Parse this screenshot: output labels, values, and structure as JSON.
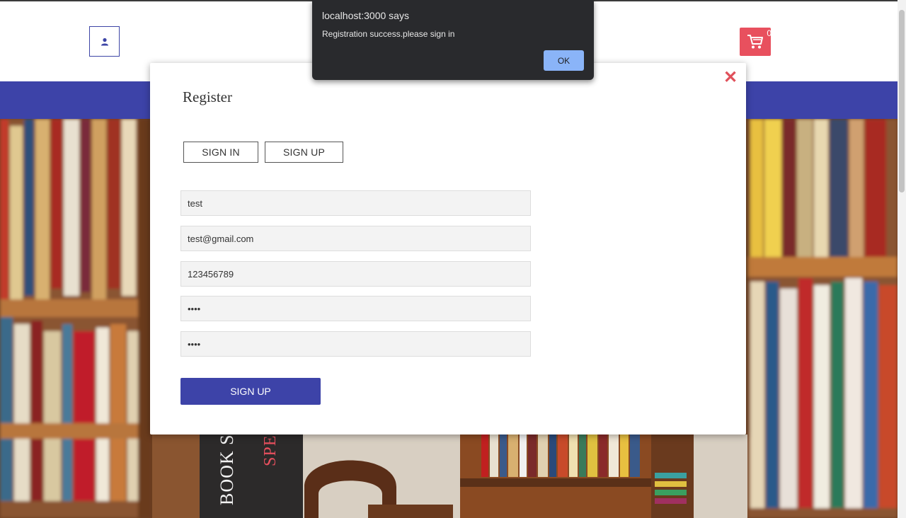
{
  "header": {
    "user_icon": "user-icon",
    "cart_icon": "cart-icon",
    "cart_count": "0",
    "accent_color": "#3d43a8",
    "cart_color": "#e8505e"
  },
  "hero": {
    "sign_text_1": "BOOK S",
    "sign_text_2": "SPE"
  },
  "modal": {
    "title": "Register",
    "close_icon": "close-icon",
    "close_glyph": "✕",
    "tabs": [
      {
        "label": "SIGN IN"
      },
      {
        "label": "SIGN UP"
      }
    ],
    "fields": [
      {
        "value": "test"
      },
      {
        "value": "test@gmail.com"
      },
      {
        "value": "123456789"
      },
      {
        "value": "••••"
      },
      {
        "value": "••••"
      }
    ],
    "submit_label": "SIGN UP"
  },
  "alert": {
    "title": "localhost:3000 says",
    "message": "Registration success.please sign in",
    "ok_label": "OK"
  }
}
